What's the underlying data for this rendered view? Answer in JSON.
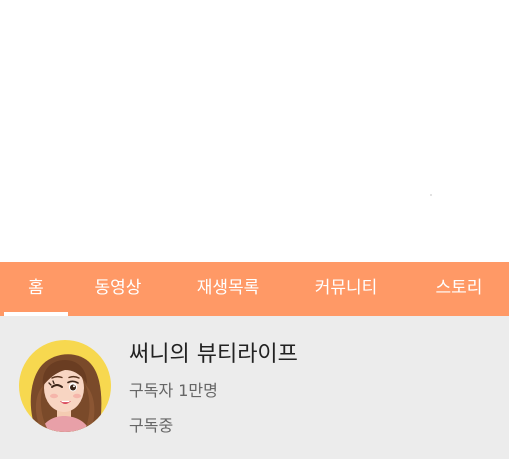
{
  "tabs": [
    {
      "label": "홈",
      "active": true
    },
    {
      "label": "동영상",
      "active": false
    },
    {
      "label": "재생목록",
      "active": false
    },
    {
      "label": "커뮤니티",
      "active": false
    },
    {
      "label": "스토리",
      "active": false
    }
  ],
  "channel": {
    "name": "써니의 뷰티라이프",
    "subscribers": "구독자 1만명",
    "subscribe_status": "구독중"
  },
  "colors": {
    "tab_bar": "#ff9966",
    "tab_text": "#ffffff",
    "profile_background": "#ececec",
    "avatar_background": "#f7d84f"
  },
  "icons": {
    "avatar": "cartoon-woman-winking-avatar"
  }
}
